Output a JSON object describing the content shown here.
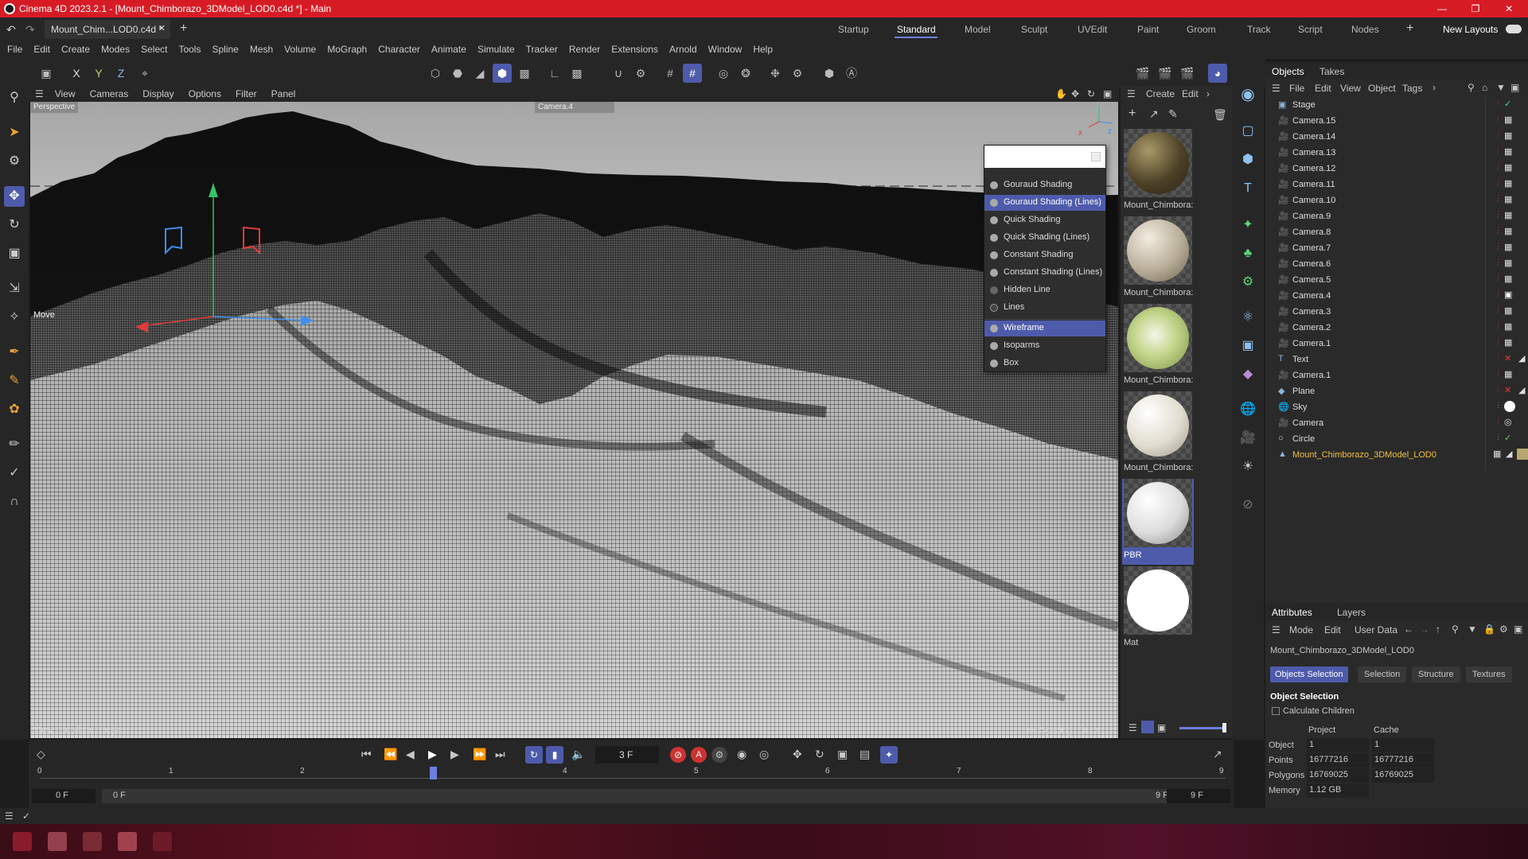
{
  "window": {
    "title": "Cinema 4D 2023.2.1 - [Mount_Chimborazo_3DModel_LOD0.c4d *] - Main"
  },
  "doc_tab": {
    "label": "Mount_Chim...LOD0.c4d *"
  },
  "layouts": [
    "Startup",
    "Standard",
    "Model",
    "Sculpt",
    "UVEdit",
    "Paint",
    "Groom",
    "Track",
    "Script",
    "Nodes"
  ],
  "active_layout": "Standard",
  "new_layouts_label": "New Layouts",
  "menu": [
    "File",
    "Edit",
    "Create",
    "Modes",
    "Select",
    "Tools",
    "Spline",
    "Mesh",
    "Volume",
    "MoGraph",
    "Character",
    "Animate",
    "Simulate",
    "Tracker",
    "Render",
    "Extensions",
    "Arnold",
    "Window",
    "Help"
  ],
  "axis_buttons": [
    "X",
    "Y",
    "Z"
  ],
  "viewport": {
    "menu": [
      "View",
      "Cameras",
      "Display",
      "Options",
      "Filter",
      "Panel"
    ],
    "label_perspective": "Perspective",
    "label_camera": "Camera.4",
    "move_label": "Move",
    "bottom_left": "View Transform: Project",
    "grid_spacing": "Grid Spacing : 50 cm"
  },
  "shading_menu": {
    "items": [
      "Gouraud Shading",
      "Gouraud Shading (Lines)",
      "Quick Shading",
      "Quick Shading (Lines)",
      "Constant Shading",
      "Constant Shading (Lines)",
      "Hidden Line",
      "Lines",
      "Wireframe",
      "Isoparms",
      "Box"
    ],
    "selected": [
      "Gouraud Shading (Lines)",
      "Wireframe"
    ]
  },
  "materials_panel": {
    "menu": [
      "Create",
      "Edit"
    ],
    "materials": [
      {
        "name": "Mount_Chimbora:",
        "color": "#6b5a3a"
      },
      {
        "name": "Mount_Chimbora:",
        "color": "#c8bfae"
      },
      {
        "name": "Mount_Chimbora:",
        "color": "#b6c98a"
      },
      {
        "name": "Mount_Chimbora:",
        "color": "#e6e2d8"
      },
      {
        "name": "PBR",
        "color": "#e8e8e8"
      },
      {
        "name": "Mat",
        "color": "#ffffff"
      }
    ]
  },
  "objects_panel": {
    "tabs": [
      "Objects",
      "Takes"
    ],
    "menu": [
      "File",
      "Edit",
      "View",
      "Object",
      "Tags"
    ],
    "objects": [
      "Stage",
      "Camera.15",
      "Camera.14",
      "Camera.13",
      "Camera.12",
      "Camera.11",
      "Camera.10",
      "Camera.9",
      "Camera.8",
      "Camera.7",
      "Camera.6",
      "Camera.5",
      "Camera.4",
      "Camera.3",
      "Camera.2",
      "Camera.1",
      "Text",
      "Camera.1",
      "Plane",
      "Sky",
      "Camera",
      "Circle",
      "Mount_Chimborazo_3DModel_LOD0"
    ]
  },
  "attributes_panel": {
    "tabs": [
      "Attributes",
      "Layers"
    ],
    "menu": [
      "Mode",
      "Edit",
      "User Data"
    ],
    "object_name": "Mount_Chimborazo_3DModel_LOD0",
    "subtabs": [
      "Objects Selection",
      "Selection",
      "Structure",
      "Textures"
    ],
    "section": "Object Selection",
    "checkbox_label": "Calculate Children",
    "col_project": "Project",
    "col_cache": "Cache",
    "rows": [
      {
        "label": "Object",
        "project": "1",
        "cache": "1"
      },
      {
        "label": "Points",
        "project": "16777216",
        "cache": "16777216"
      },
      {
        "label": "Polygons",
        "project": "16769025",
        "cache": "16769025"
      },
      {
        "label": "Memory",
        "project": "1.12 GB",
        "cache": ""
      }
    ]
  },
  "timeline": {
    "current_frame": "3 F",
    "ruler": [
      "0",
      "1",
      "2",
      "3",
      "4",
      "5",
      "6",
      "7",
      "8",
      "9"
    ],
    "start": "0 F",
    "range_start": "0 F",
    "range_end": "9 F",
    "end": "9 F"
  }
}
